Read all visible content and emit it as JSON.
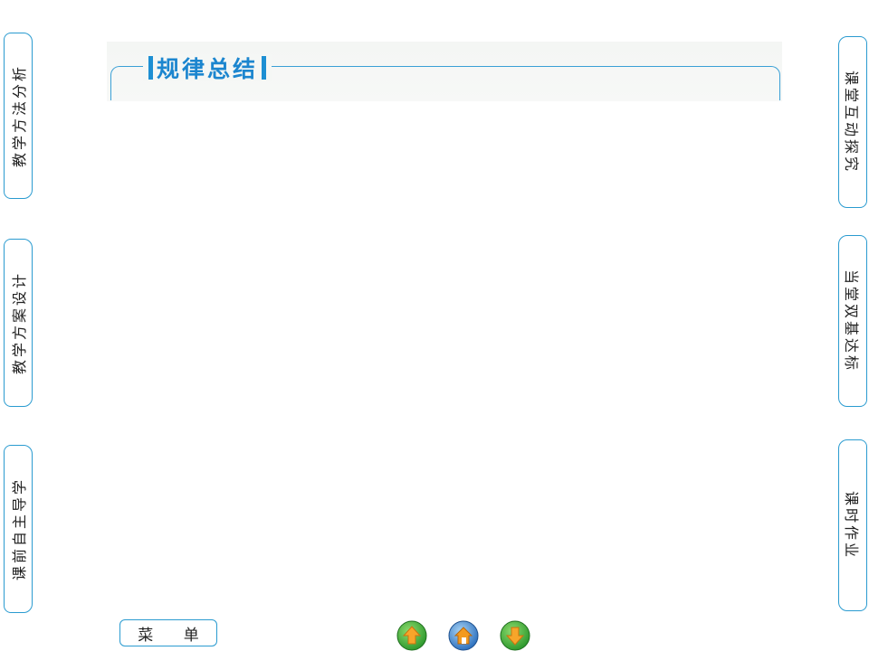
{
  "left_tabs": [
    {
      "label": "教学方法分析"
    },
    {
      "label": "教学方案设计"
    },
    {
      "label": "课前自主导学"
    }
  ],
  "right_tabs": [
    {
      "label": "课堂互动探究"
    },
    {
      "label": "当堂双基达标"
    },
    {
      "label": "课时作业"
    }
  ],
  "header": {
    "title": "规律总结"
  },
  "footer": {
    "menu_label": "菜 单",
    "nav": {
      "prev_icon": "up-arrow-icon",
      "home_icon": "home-icon",
      "next_icon": "down-arrow-icon"
    }
  },
  "colors": {
    "accent": "#1c86cf",
    "border": "#2a9bd0",
    "nav_green": "#3aa53a",
    "nav_orange": "#f39a1e",
    "nav_blue": "#2f7fc8"
  }
}
